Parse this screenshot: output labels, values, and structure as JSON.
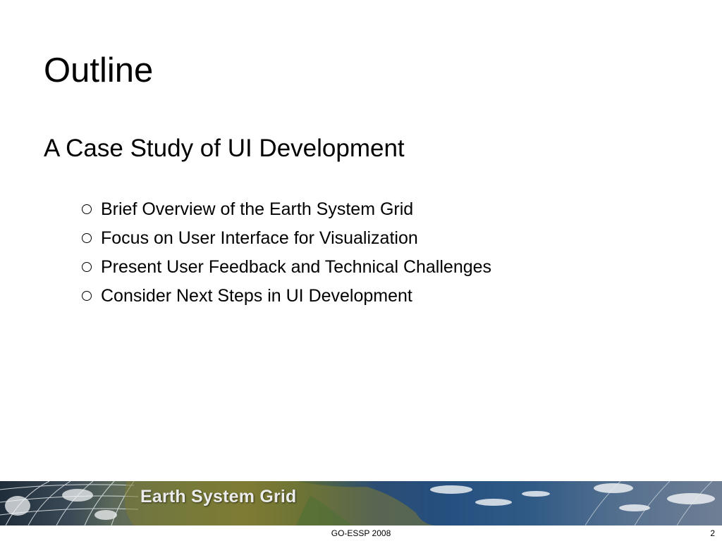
{
  "slide": {
    "title": "Outline",
    "subtitle": "A Case Study of UI Development",
    "bullets": [
      "Brief Overview of the Earth System Grid",
      "Focus on User Interface for Visualization",
      "Present User Feedback and Technical Challenges",
      "Consider Next Steps in UI Development"
    ]
  },
  "banner": {
    "logo_text": "Earth System Grid"
  },
  "footer": {
    "center_text": "GO-ESSP 2008",
    "page_number": "2"
  },
  "colors": {
    "text": "#000000",
    "background": "#ffffff",
    "banner_ocean": "#254f7f",
    "banner_land": "#807d33",
    "logo_text": "#ececec"
  }
}
